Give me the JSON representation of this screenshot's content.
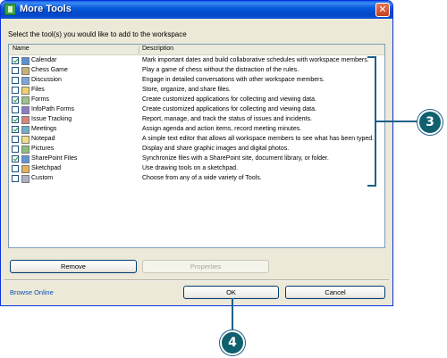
{
  "window": {
    "title": "More Tools",
    "close_glyph": "✕",
    "prompt": "Select the tool(s) you would like to add to the workspace"
  },
  "list": {
    "headers": {
      "name": "Name",
      "description": "Description"
    },
    "rows": [
      {
        "name": "Calendar",
        "description": "Mark important dates and build collaborative schedules with workspace members.",
        "checked": true,
        "icon": "calendar-icon",
        "color": "#5b8fd6"
      },
      {
        "name": "Chess Game",
        "description": "Play a game of chess without the distraction of the rules.",
        "checked": false,
        "icon": "chess-icon",
        "color": "#c9b27a"
      },
      {
        "name": "Discussion",
        "description": "Engage in detailed conversations with other workspace members.",
        "checked": false,
        "icon": "discussion-icon",
        "color": "#7ea6d9"
      },
      {
        "name": "Files",
        "description": "Store, organize, and share files.",
        "checked": false,
        "icon": "files-icon",
        "color": "#f2d06b"
      },
      {
        "name": "Forms",
        "description": "Create customized applications for collecting and viewing data.",
        "checked": true,
        "icon": "forms-icon",
        "color": "#9bc38b"
      },
      {
        "name": "InfoPath Forms",
        "description": "Create customized applications for collecting and viewing data.",
        "checked": false,
        "icon": "infopath-icon",
        "color": "#8c7ac8"
      },
      {
        "name": "Issue Tracking",
        "description": "Report, manage, and track the status of issues and incidents.",
        "checked": true,
        "icon": "issue-tracking-icon",
        "color": "#d9857a"
      },
      {
        "name": "Meetings",
        "description": "Assign agenda and action items, record meeting minutes.",
        "checked": true,
        "icon": "meetings-icon",
        "color": "#6fb0c7"
      },
      {
        "name": "Notepad",
        "description": "A simple text editor that allows all workspace members to see what has been typed.",
        "checked": false,
        "icon": "notepad-icon",
        "color": "#f0dc8a"
      },
      {
        "name": "Pictures",
        "description": "Display and share graphic images and digital photos.",
        "checked": false,
        "icon": "pictures-icon",
        "color": "#8cc07a"
      },
      {
        "name": "SharePoint Files",
        "description": "Synchronize files with a SharePoint site, document library, or folder.",
        "checked": true,
        "icon": "sharepoint-icon",
        "color": "#5f95d8"
      },
      {
        "name": "Sketchpad",
        "description": "Use drawing tools on a sketchpad.",
        "checked": false,
        "icon": "sketchpad-icon",
        "color": "#e0b35a"
      },
      {
        "name": "Custom",
        "description": "Choose from any of a wide variety of Tools.",
        "checked": false,
        "icon": "custom-icon",
        "color": "#b0b0c8"
      }
    ]
  },
  "buttons": {
    "remove": "Remove",
    "properties": "Properties",
    "browse_online": "Browse Online",
    "ok": "OK",
    "cancel": "Cancel"
  },
  "callouts": {
    "c3": "3",
    "c4": "4"
  },
  "colors": {
    "callout": "#10606f",
    "bracket": "#1b5f8a",
    "titlebar": "#0759dc",
    "dialog_bg": "#ece9d8"
  }
}
